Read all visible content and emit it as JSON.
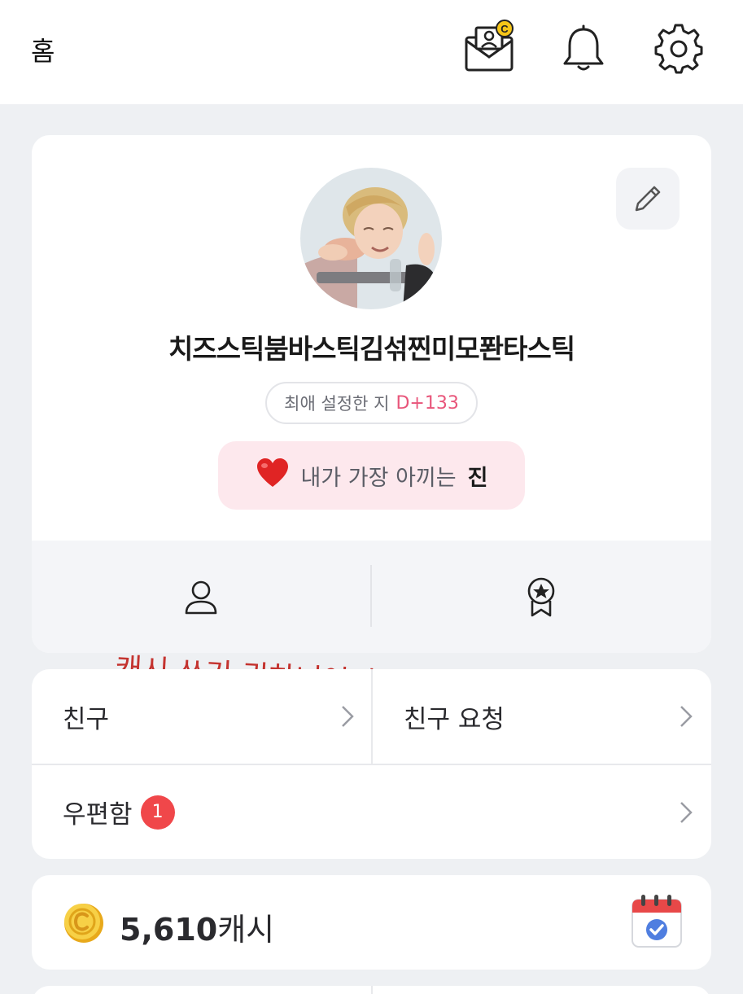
{
  "header": {
    "title": "홈",
    "icons": [
      "mail-cash-icon",
      "bell-icon",
      "settings-gear-icon"
    ],
    "mail_badge_letter": "C"
  },
  "profile": {
    "nickname": "치즈스틱붐바스틱김섞찐미모퐌타스틱",
    "dday_label": "최애 설정한 지",
    "dday_value": "D+133",
    "favorite_prefix": "내가 가장 아끼는",
    "favorite_name": "진",
    "actions": [
      "person-icon",
      "award-star-icon"
    ]
  },
  "handwritten_note": "캐시 쓰기 귀차너어어어어어얽ㄱ",
  "menu": {
    "friends": "친구",
    "friend_requests": "친구 요청",
    "mailbox": "우편함",
    "mailbox_badge": "1"
  },
  "cash": {
    "amount": "5,610",
    "unit": "캐시"
  },
  "colors": {
    "accent_pink": "#e8557a",
    "pill_pink_bg": "#fde8ed",
    "badge_red": "#f0474a",
    "page_bg": "#eef0f3",
    "coin_gold": "#f2c230"
  }
}
